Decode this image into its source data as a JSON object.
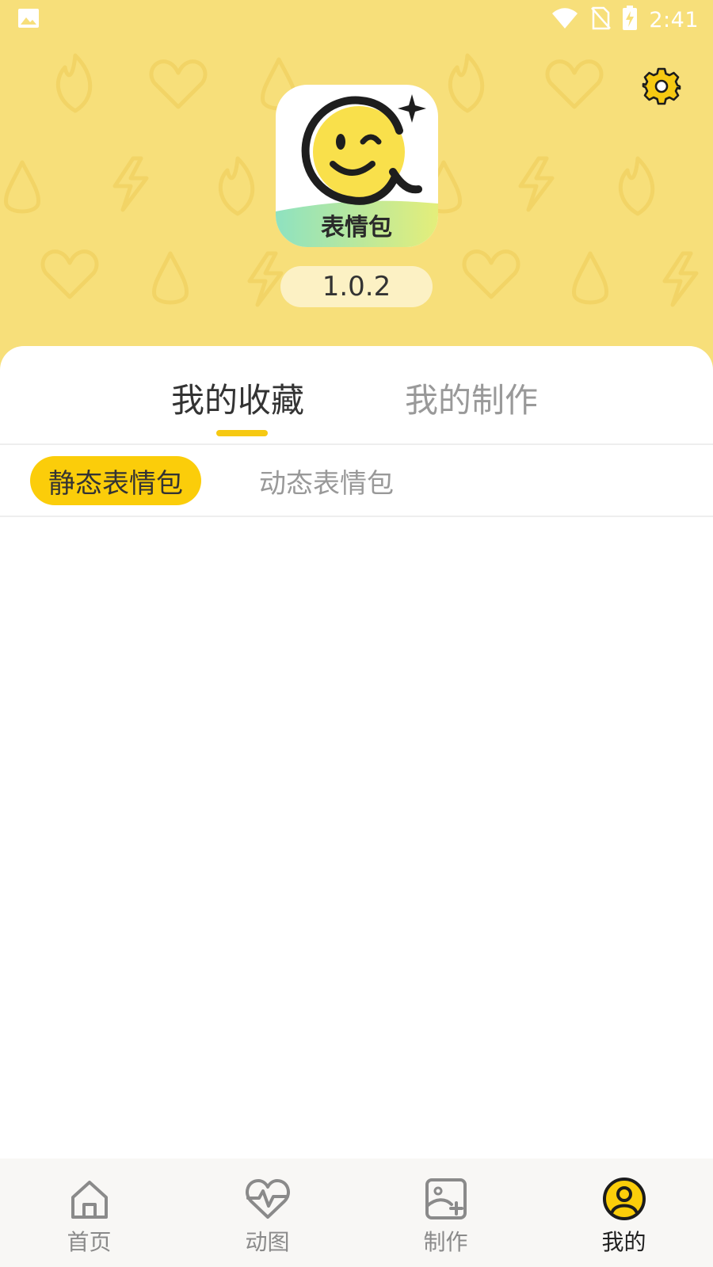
{
  "status_bar": {
    "time": "2:41",
    "icons": [
      "image-notification-icon",
      "wifi-icon",
      "no-sim-icon",
      "battery-charging-icon"
    ]
  },
  "header": {
    "background_color": "#f7df7a",
    "settings_icon": "gear-icon",
    "logo_text": "表情包",
    "version": "1.0.2"
  },
  "main_tabs": [
    {
      "label": "我的收藏",
      "active": true
    },
    {
      "label": "我的制作",
      "active": false
    }
  ],
  "sub_tabs": [
    {
      "label": "静态表情包",
      "active": true
    },
    {
      "label": "动态表情包",
      "active": false
    }
  ],
  "bottom_nav": [
    {
      "label": "首页",
      "icon": "home-icon",
      "active": false
    },
    {
      "label": "动图",
      "icon": "heartbeat-icon",
      "active": false
    },
    {
      "label": "制作",
      "icon": "image-add-icon",
      "active": false
    },
    {
      "label": "我的",
      "icon": "user-icon",
      "active": true
    }
  ],
  "colors": {
    "accent": "#fbcd0a",
    "indicator": "#f6c912",
    "header": "#f7df7a"
  }
}
